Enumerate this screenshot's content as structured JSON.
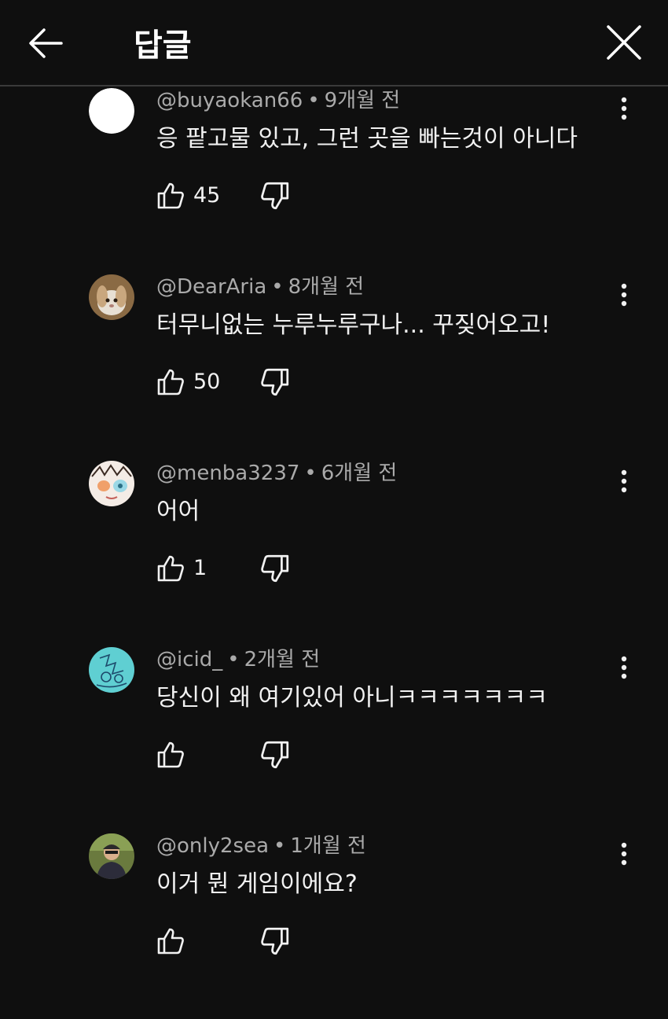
{
  "header": {
    "title": "답글",
    "back_icon": "arrow-left-icon",
    "close_icon": "close-icon"
  },
  "colors": {
    "background": "#0f0f0f",
    "text_primary": "#f1f1f1",
    "text_secondary": "#aaaaaa",
    "divider": "#3a3a3a"
  },
  "comments": [
    {
      "author": "@buyaokan66",
      "time": "9개월 전",
      "text": "응 팥고물 있고, 그런 곳을 빠는것이 아니다",
      "likes": "45",
      "avatar": "white-circle"
    },
    {
      "author": "@DearAria",
      "time": "8개월 전",
      "text": "터무니없는 누루누루구나... 꾸짖어오고!",
      "likes": "50",
      "avatar": "rabbit"
    },
    {
      "author": "@menba3237",
      "time": "6개월 전",
      "text": "어어",
      "likes": "1",
      "avatar": "anime-face"
    },
    {
      "author": "@icid_",
      "time": "2개월 전",
      "text": "당신이 왜 여기있어 아니ㅋㅋㅋㅋㅋㅋㅋ",
      "likes": "",
      "avatar": "cyan-drawing"
    },
    {
      "author": "@only2sea",
      "time": "1개월 전",
      "text": "이거 뭔 게임이에요?",
      "likes": "",
      "avatar": "person-photo"
    }
  ]
}
